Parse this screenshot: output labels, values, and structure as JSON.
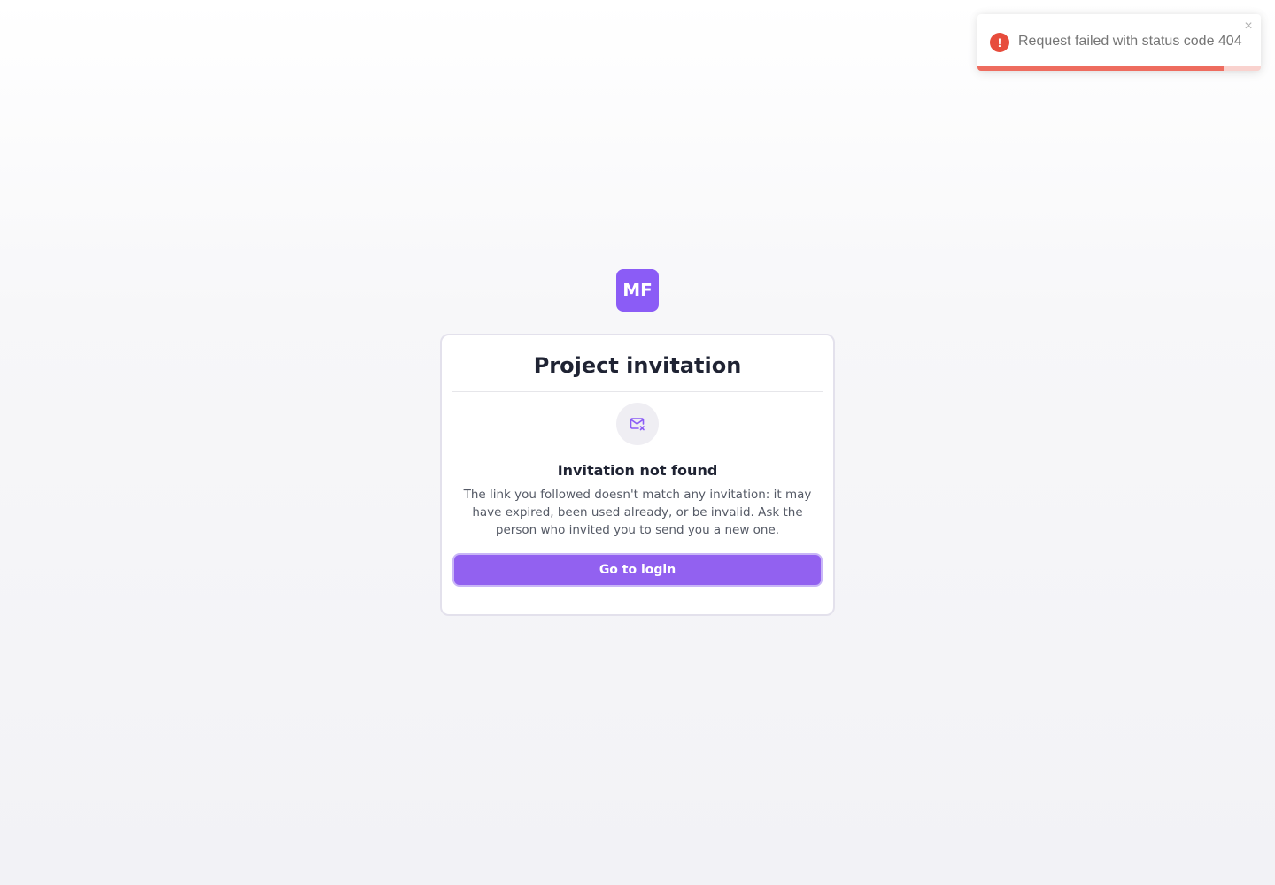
{
  "toast": {
    "message": "Request failed with status code 404",
    "icon": "error-icon",
    "icon_glyph": "!",
    "close_glyph": "×",
    "progress_fraction": 0.87,
    "color": "#e74c3c"
  },
  "logo": {
    "text": "MF",
    "color": "#8b5cf6"
  },
  "card": {
    "title": "Project invitation",
    "icon": "mail-x-icon",
    "subtitle": "Invitation not found",
    "description": "The link you followed doesn't match any invitation: it may have expired, been used already, or be invalid. Ask the person who invited you to send you a new one.",
    "button_label": "Go to login",
    "accent_color": "#9261f0"
  }
}
